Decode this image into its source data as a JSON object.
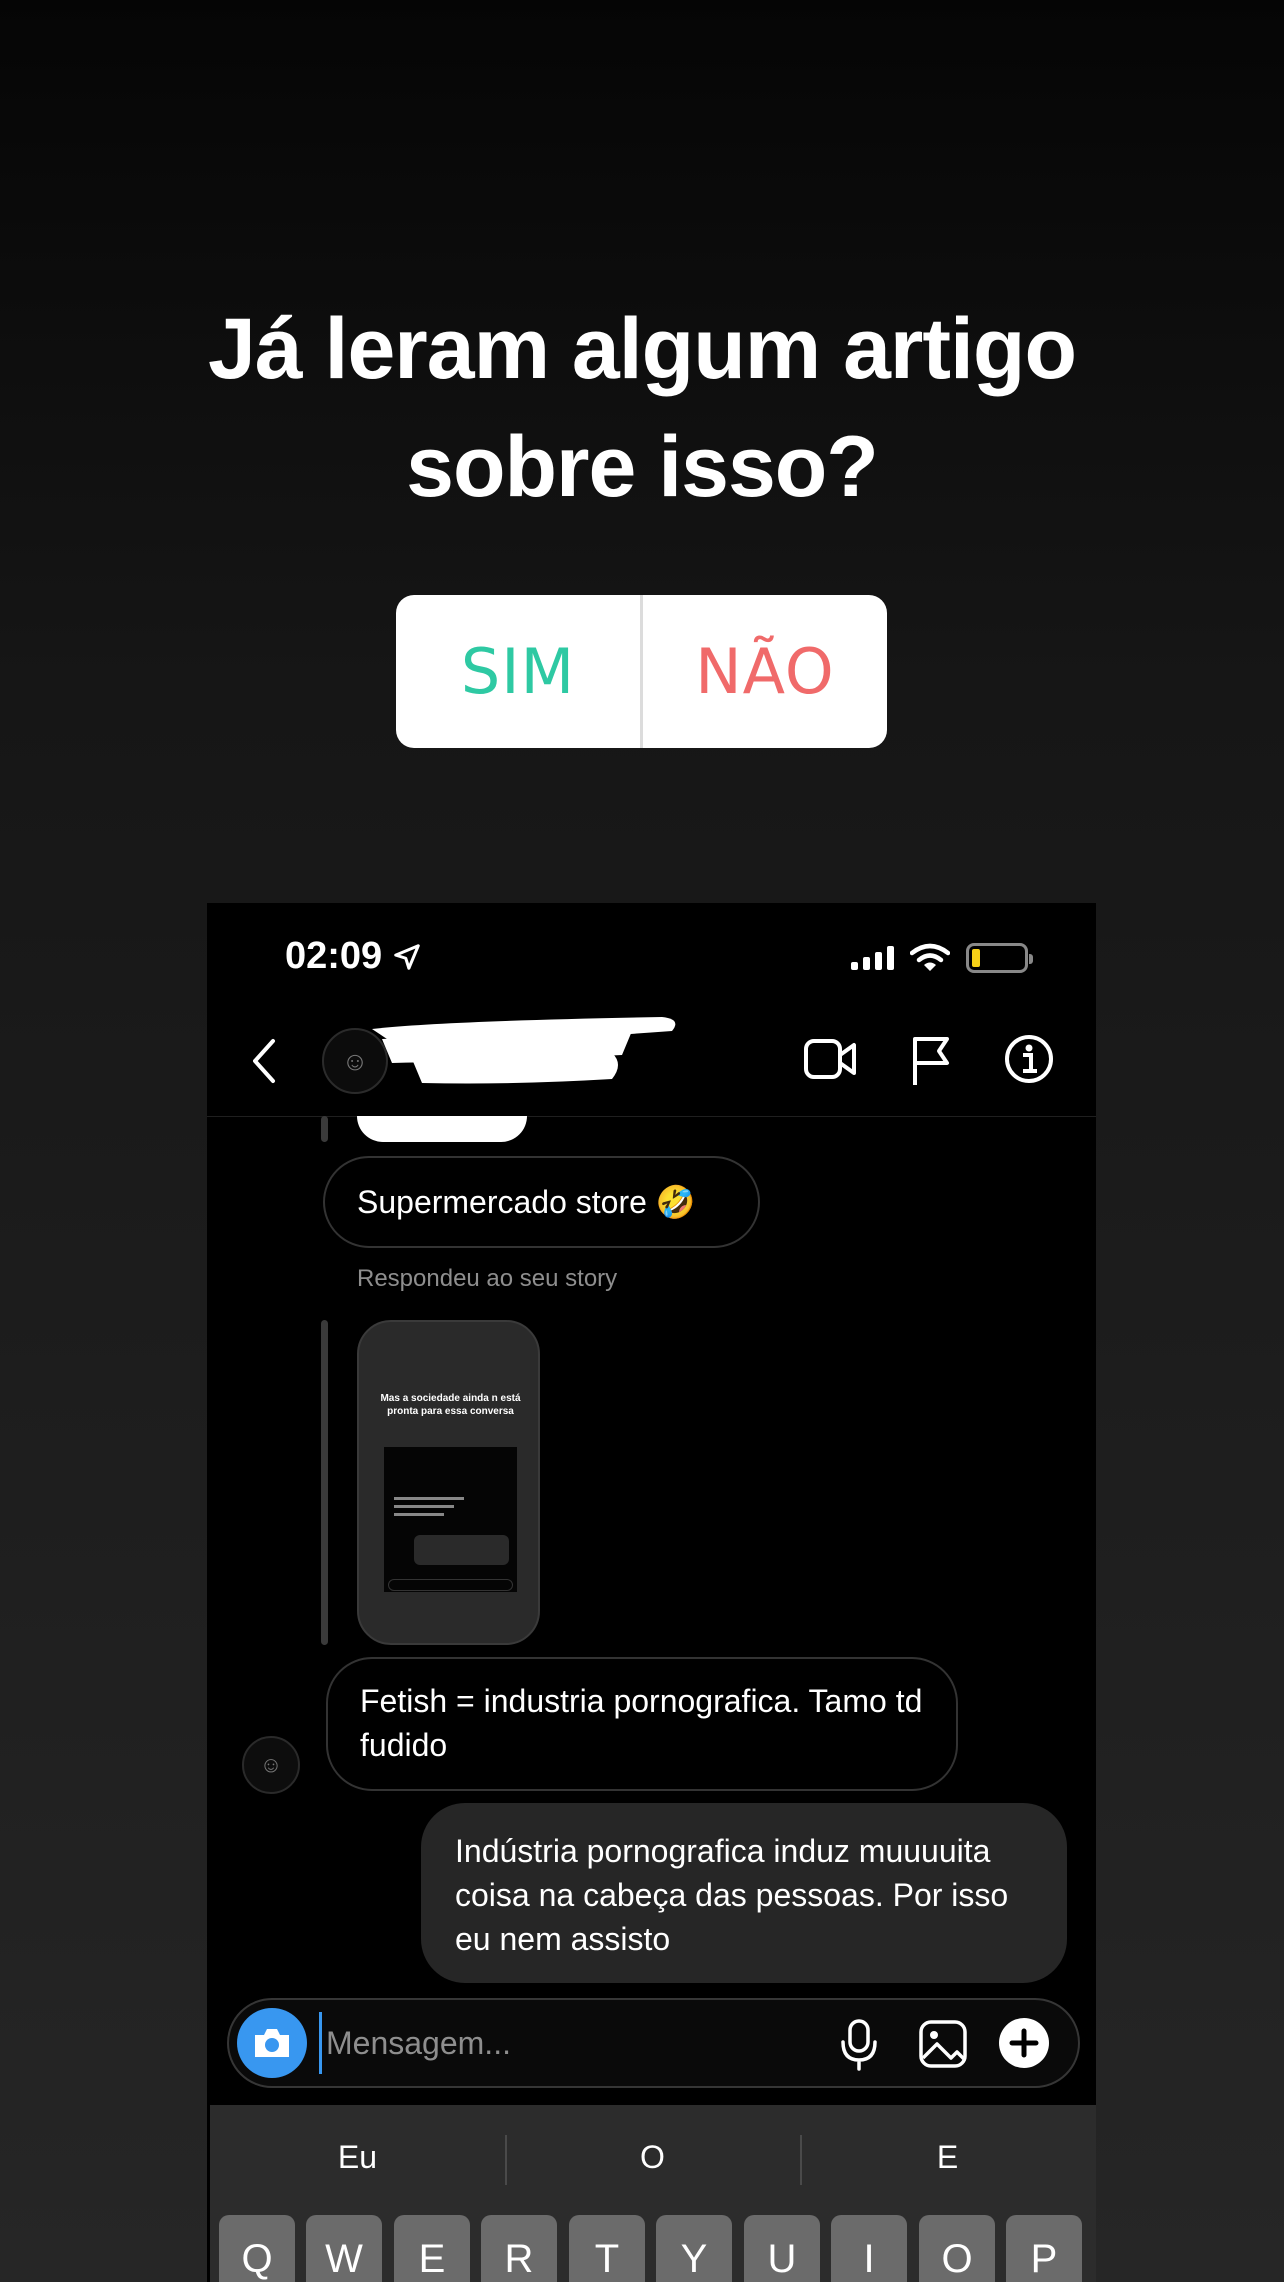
{
  "story": {
    "title_line1": "Já leram algum artigo",
    "title_line2": "sobre isso?",
    "poll": {
      "option_yes": "SIM",
      "option_no": "NÃO",
      "yes_color": "#2ec9a3",
      "no_color": "#f06a6a"
    }
  },
  "status_bar": {
    "time": "02:09",
    "battery_color": "#f7d117"
  },
  "chat": {
    "messages": [
      {
        "from": "them",
        "text": "Supermercado store 🤣"
      },
      {
        "from": "them",
        "type": "story_reply_label",
        "text": "Respondeu ao seu story"
      },
      {
        "from": "them",
        "text": "Fetish = industria pornografica. Tamo td fudido"
      },
      {
        "from": "me",
        "text": "Indústria pornografica induz muuuuita coisa na cabeça das pessoas. Por isso eu nem assisto"
      }
    ],
    "story_thumb_title": "Mas a sociedade ainda n está pronta para essa conversa"
  },
  "composer": {
    "placeholder": "Mensagem...",
    "accent": "#3897f0"
  },
  "keyboard": {
    "suggestions": [
      "Eu",
      "O",
      "E"
    ],
    "row1": [
      "Q",
      "W",
      "E",
      "R",
      "T",
      "Y",
      "U",
      "I",
      "O",
      "P"
    ]
  }
}
